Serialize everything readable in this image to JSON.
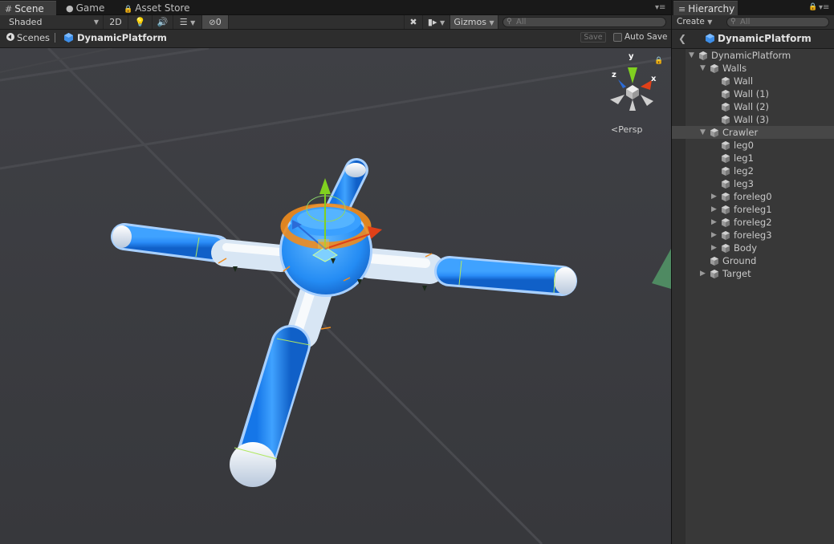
{
  "tabs": {
    "scene": "Scene",
    "game": "Game",
    "asset_store": "Asset Store",
    "hierarchy": "Hierarchy"
  },
  "scene_toolbar": {
    "shading": "Shaded",
    "mode_2d": "2D",
    "hidden_count": "0",
    "gizmos": "Gizmos",
    "search_placeholder": "All"
  },
  "breadcrumb": {
    "scenes": "Scenes",
    "current": "DynamicPlatform",
    "save": "Save",
    "auto_save": "Auto Save"
  },
  "viewport": {
    "projection": "Persp",
    "axis_x": "x",
    "axis_y": "y",
    "axis_z": "z"
  },
  "hierarchy": {
    "create": "Create",
    "search_placeholder": "All",
    "header_title": "DynamicPlatform",
    "items": [
      {
        "label": "DynamicPlatform",
        "expand": "open"
      },
      {
        "label": "Walls",
        "expand": "open"
      },
      {
        "label": "Wall",
        "expand": "none"
      },
      {
        "label": "Wall (1)",
        "expand": "none"
      },
      {
        "label": "Wall (2)",
        "expand": "none"
      },
      {
        "label": "Wall (3)",
        "expand": "none"
      },
      {
        "label": "Crawler",
        "expand": "open",
        "selected": true
      },
      {
        "label": "leg0",
        "expand": "none"
      },
      {
        "label": "leg1",
        "expand": "none"
      },
      {
        "label": "leg2",
        "expand": "none"
      },
      {
        "label": "leg3",
        "expand": "none"
      },
      {
        "label": "foreleg0",
        "expand": "closed"
      },
      {
        "label": "foreleg1",
        "expand": "closed"
      },
      {
        "label": "foreleg2",
        "expand": "closed"
      },
      {
        "label": "foreleg3",
        "expand": "closed"
      },
      {
        "label": "Body",
        "expand": "closed"
      },
      {
        "label": "Ground",
        "expand": "none"
      },
      {
        "label": "Target",
        "expand": "closed"
      }
    ]
  },
  "colors": {
    "selection_blue": "#1e8cff",
    "outline_orange": "#f08c1e",
    "axis_x": "#e04018",
    "axis_y": "#80d020",
    "axis_z": "#2b6bd8"
  }
}
